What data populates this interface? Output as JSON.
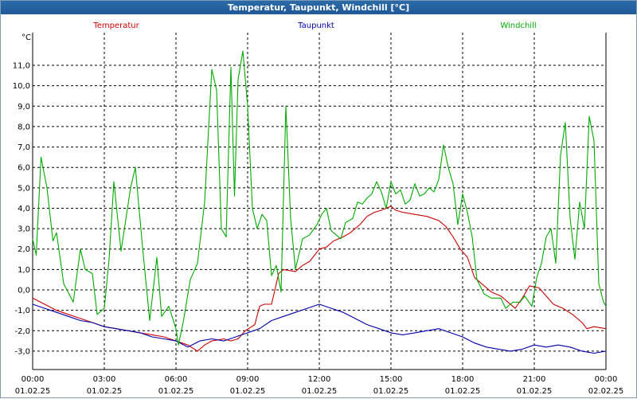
{
  "window": {
    "title": "Temperatur, Taupunkt, Windchill [°C]"
  },
  "chart_data": {
    "type": "line",
    "title": "Temperatur, Taupunkt, Windchill [°C]",
    "ylabel": "°C",
    "ylim": [
      -3.9,
      12.6
    ],
    "xlim": [
      0,
      24
    ],
    "grid": true,
    "legend_position": "top",
    "y_ticks": [
      {
        "v": 11,
        "label": "11,0"
      },
      {
        "v": 10,
        "label": "10,0"
      },
      {
        "v": 9,
        "label": "9,0"
      },
      {
        "v": 8,
        "label": "8,0"
      },
      {
        "v": 7,
        "label": "7,0"
      },
      {
        "v": 6,
        "label": "6,0"
      },
      {
        "v": 5,
        "label": "5,0"
      },
      {
        "v": 4,
        "label": "4,0"
      },
      {
        "v": 3,
        "label": "3,0"
      },
      {
        "v": 2,
        "label": "2,0"
      },
      {
        "v": 1,
        "label": "1,0"
      },
      {
        "v": 0,
        "label": "0,0"
      },
      {
        "v": -1,
        "label": "-1,0"
      },
      {
        "v": -2,
        "label": "-2,0"
      },
      {
        "v": -3,
        "label": "-3,0"
      }
    ],
    "x_ticks": [
      {
        "v": 0,
        "time": "00:00",
        "date": "01.02.25"
      },
      {
        "v": 3,
        "time": "03:00",
        "date": "01.02.25"
      },
      {
        "v": 6,
        "time": "06:00",
        "date": "01.02.25"
      },
      {
        "v": 9,
        "time": "09:00",
        "date": "01.02.25"
      },
      {
        "v": 12,
        "time": "12:00",
        "date": "01.02.25"
      },
      {
        "v": 15,
        "time": "15:00",
        "date": "01.02.25"
      },
      {
        "v": 18,
        "time": "18:00",
        "date": "01.02.25"
      },
      {
        "v": 21,
        "time": "21:00",
        "date": "01.02.25"
      },
      {
        "v": 24,
        "time": "00:00",
        "date": "02.02.25"
      }
    ],
    "series": [
      {
        "name": "Temperatur",
        "color": "#cc0000",
        "points": [
          [
            0,
            -0.4
          ],
          [
            0.5,
            -0.7
          ],
          [
            1,
            -1.0
          ],
          [
            1.5,
            -1.2
          ],
          [
            2,
            -1.4
          ],
          [
            2.5,
            -1.6
          ],
          [
            3,
            -1.8
          ],
          [
            3.5,
            -1.9
          ],
          [
            4,
            -2.0
          ],
          [
            4.5,
            -2.1
          ],
          [
            5,
            -2.2
          ],
          [
            5.5,
            -2.3
          ],
          [
            6,
            -2.5
          ],
          [
            6.5,
            -2.7
          ],
          [
            6.9,
            -3.0
          ],
          [
            7.2,
            -2.7
          ],
          [
            7.5,
            -2.5
          ],
          [
            8,
            -2.4
          ],
          [
            8.3,
            -2.5
          ],
          [
            8.6,
            -2.4
          ],
          [
            8.9,
            -2.0
          ],
          [
            9.3,
            -1.7
          ],
          [
            9.5,
            -0.8
          ],
          [
            9.7,
            -0.7
          ],
          [
            10,
            -0.7
          ],
          [
            10.3,
            0.8
          ],
          [
            10.5,
            1.0
          ],
          [
            11,
            0.9
          ],
          [
            11.3,
            1.2
          ],
          [
            11.6,
            1.4
          ],
          [
            12,
            2.0
          ],
          [
            12.3,
            2.1
          ],
          [
            12.6,
            2.4
          ],
          [
            13,
            2.6
          ],
          [
            13.3,
            2.8
          ],
          [
            13.7,
            3.2
          ],
          [
            14,
            3.6
          ],
          [
            14.3,
            3.8
          ],
          [
            14.6,
            3.9
          ],
          [
            15,
            4.1
          ],
          [
            15.2,
            3.9
          ],
          [
            15.5,
            3.8
          ],
          [
            16,
            3.7
          ],
          [
            16.5,
            3.6
          ],
          [
            17,
            3.4
          ],
          [
            17.3,
            3.1
          ],
          [
            17.6,
            2.6
          ],
          [
            17.9,
            2.0
          ],
          [
            18.2,
            1.6
          ],
          [
            18.5,
            0.6
          ],
          [
            18.8,
            0.3
          ],
          [
            19.2,
            -0.1
          ],
          [
            19.6,
            -0.3
          ],
          [
            19.9,
            -0.6
          ],
          [
            20.2,
            -0.9
          ],
          [
            20.5,
            -0.4
          ],
          [
            20.8,
            0.2
          ],
          [
            21.2,
            0.1
          ],
          [
            21.5,
            -0.3
          ],
          [
            21.8,
            -0.7
          ],
          [
            22.2,
            -0.9
          ],
          [
            22.6,
            -1.2
          ],
          [
            23,
            -1.6
          ],
          [
            23.2,
            -1.9
          ],
          [
            23.5,
            -1.8
          ],
          [
            24,
            -1.9
          ]
        ]
      },
      {
        "name": "Taupunkt",
        "color": "#0000aa",
        "points": [
          [
            0,
            -0.7
          ],
          [
            0.5,
            -0.9
          ],
          [
            1,
            -1.1
          ],
          [
            1.5,
            -1.3
          ],
          [
            2,
            -1.5
          ],
          [
            2.5,
            -1.6
          ],
          [
            3,
            -1.8
          ],
          [
            3.5,
            -1.9
          ],
          [
            4,
            -2.0
          ],
          [
            4.5,
            -2.1
          ],
          [
            5,
            -2.3
          ],
          [
            5.5,
            -2.4
          ],
          [
            6,
            -2.5
          ],
          [
            6.5,
            -2.8
          ],
          [
            7,
            -2.5
          ],
          [
            7.5,
            -2.4
          ],
          [
            8,
            -2.5
          ],
          [
            8.5,
            -2.3
          ],
          [
            9,
            -2.1
          ],
          [
            9.5,
            -1.9
          ],
          [
            10,
            -1.5
          ],
          [
            10.5,
            -1.3
          ],
          [
            11,
            -1.1
          ],
          [
            11.5,
            -0.9
          ],
          [
            12,
            -0.7
          ],
          [
            12.5,
            -0.9
          ],
          [
            13,
            -1.1
          ],
          [
            13.5,
            -1.4
          ],
          [
            14,
            -1.7
          ],
          [
            14.5,
            -1.9
          ],
          [
            15,
            -2.1
          ],
          [
            15.5,
            -2.2
          ],
          [
            16,
            -2.1
          ],
          [
            16.5,
            -2.0
          ],
          [
            17,
            -1.9
          ],
          [
            17.5,
            -2.1
          ],
          [
            18,
            -2.3
          ],
          [
            18.5,
            -2.6
          ],
          [
            19,
            -2.8
          ],
          [
            19.5,
            -2.9
          ],
          [
            20,
            -3.0
          ],
          [
            20.5,
            -2.9
          ],
          [
            21,
            -2.7
          ],
          [
            21.5,
            -2.8
          ],
          [
            22,
            -2.7
          ],
          [
            22.5,
            -2.8
          ],
          [
            23,
            -3.0
          ],
          [
            23.5,
            -3.1
          ],
          [
            24,
            -3.0
          ]
        ]
      },
      {
        "name": "Windchill",
        "color": "#00aa00",
        "points": [
          [
            0,
            2.5
          ],
          [
            0.15,
            1.7
          ],
          [
            0.35,
            6.5
          ],
          [
            0.6,
            5.0
          ],
          [
            0.85,
            2.4
          ],
          [
            1,
            2.8
          ],
          [
            1.3,
            0.3
          ],
          [
            1.7,
            -0.6
          ],
          [
            2,
            2.0
          ],
          [
            2.2,
            1.0
          ],
          [
            2.5,
            0.8
          ],
          [
            2.7,
            -1.2
          ],
          [
            3,
            -0.9
          ],
          [
            3.2,
            1.5
          ],
          [
            3.4,
            5.3
          ],
          [
            3.7,
            1.9
          ],
          [
            4.1,
            5.0
          ],
          [
            4.3,
            6.0
          ],
          [
            4.6,
            2.1
          ],
          [
            4.9,
            -1.5
          ],
          [
            5.2,
            1.6
          ],
          [
            5.4,
            -1.3
          ],
          [
            5.7,
            -0.8
          ],
          [
            6,
            -1.9
          ],
          [
            6.1,
            -2.7
          ],
          [
            6.3,
            -1.6
          ],
          [
            6.6,
            0.5
          ],
          [
            6.9,
            1.3
          ],
          [
            7.2,
            4.3
          ],
          [
            7.5,
            10.8
          ],
          [
            7.7,
            9.8
          ],
          [
            7.9,
            3.0
          ],
          [
            8.1,
            2.6
          ],
          [
            8.3,
            10.9
          ],
          [
            8.45,
            4.6
          ],
          [
            8.6,
            10.3
          ],
          [
            8.8,
            11.7
          ],
          [
            9,
            9.0
          ],
          [
            9.2,
            4.0
          ],
          [
            9.4,
            3.0
          ],
          [
            9.6,
            3.7
          ],
          [
            9.8,
            3.4
          ],
          [
            10,
            0.7
          ],
          [
            10.2,
            1.2
          ],
          [
            10.4,
            -0.1
          ],
          [
            10.6,
            9.0
          ],
          [
            10.8,
            3.5
          ],
          [
            11,
            1.0
          ],
          [
            11.3,
            2.5
          ],
          [
            11.6,
            2.7
          ],
          [
            11.9,
            3.2
          ],
          [
            12.1,
            3.7
          ],
          [
            12.3,
            4.0
          ],
          [
            12.5,
            2.9
          ],
          [
            12.7,
            2.7
          ],
          [
            12.9,
            2.5
          ],
          [
            13.1,
            3.3
          ],
          [
            13.4,
            3.5
          ],
          [
            13.6,
            4.3
          ],
          [
            13.8,
            4.2
          ],
          [
            14,
            4.5
          ],
          [
            14.2,
            4.7
          ],
          [
            14.4,
            5.3
          ],
          [
            14.6,
            4.8
          ],
          [
            14.8,
            4.0
          ],
          [
            15,
            5.3
          ],
          [
            15.2,
            4.7
          ],
          [
            15.4,
            4.9
          ],
          [
            15.6,
            4.2
          ],
          [
            15.8,
            4.4
          ],
          [
            16,
            5.2
          ],
          [
            16.2,
            4.6
          ],
          [
            16.4,
            4.7
          ],
          [
            16.6,
            5.0
          ],
          [
            16.8,
            4.8
          ],
          [
            17,
            5.4
          ],
          [
            17.2,
            7.1
          ],
          [
            17.4,
            6.0
          ],
          [
            17.6,
            5.2
          ],
          [
            17.8,
            3.2
          ],
          [
            18,
            4.7
          ],
          [
            18.2,
            3.8
          ],
          [
            18.4,
            2.6
          ],
          [
            18.6,
            0.5
          ],
          [
            18.9,
            -0.2
          ],
          [
            19.2,
            -0.4
          ],
          [
            19.6,
            -0.4
          ],
          [
            19.8,
            -0.9
          ],
          [
            20.1,
            -0.6
          ],
          [
            20.4,
            -0.6
          ],
          [
            20.6,
            -0.3
          ],
          [
            20.9,
            -0.8
          ],
          [
            21.1,
            0.6
          ],
          [
            21.3,
            1.3
          ],
          [
            21.5,
            2.6
          ],
          [
            21.7,
            3.0
          ],
          [
            21.9,
            1.3
          ],
          [
            22.1,
            6.6
          ],
          [
            22.3,
            8.2
          ],
          [
            22.5,
            3.5
          ],
          [
            22.7,
            1.5
          ],
          [
            22.9,
            4.3
          ],
          [
            23.1,
            3.0
          ],
          [
            23.3,
            8.5
          ],
          [
            23.5,
            7.3
          ],
          [
            23.7,
            0.3
          ],
          [
            23.9,
            -0.6
          ],
          [
            24,
            -0.8
          ]
        ]
      }
    ]
  }
}
